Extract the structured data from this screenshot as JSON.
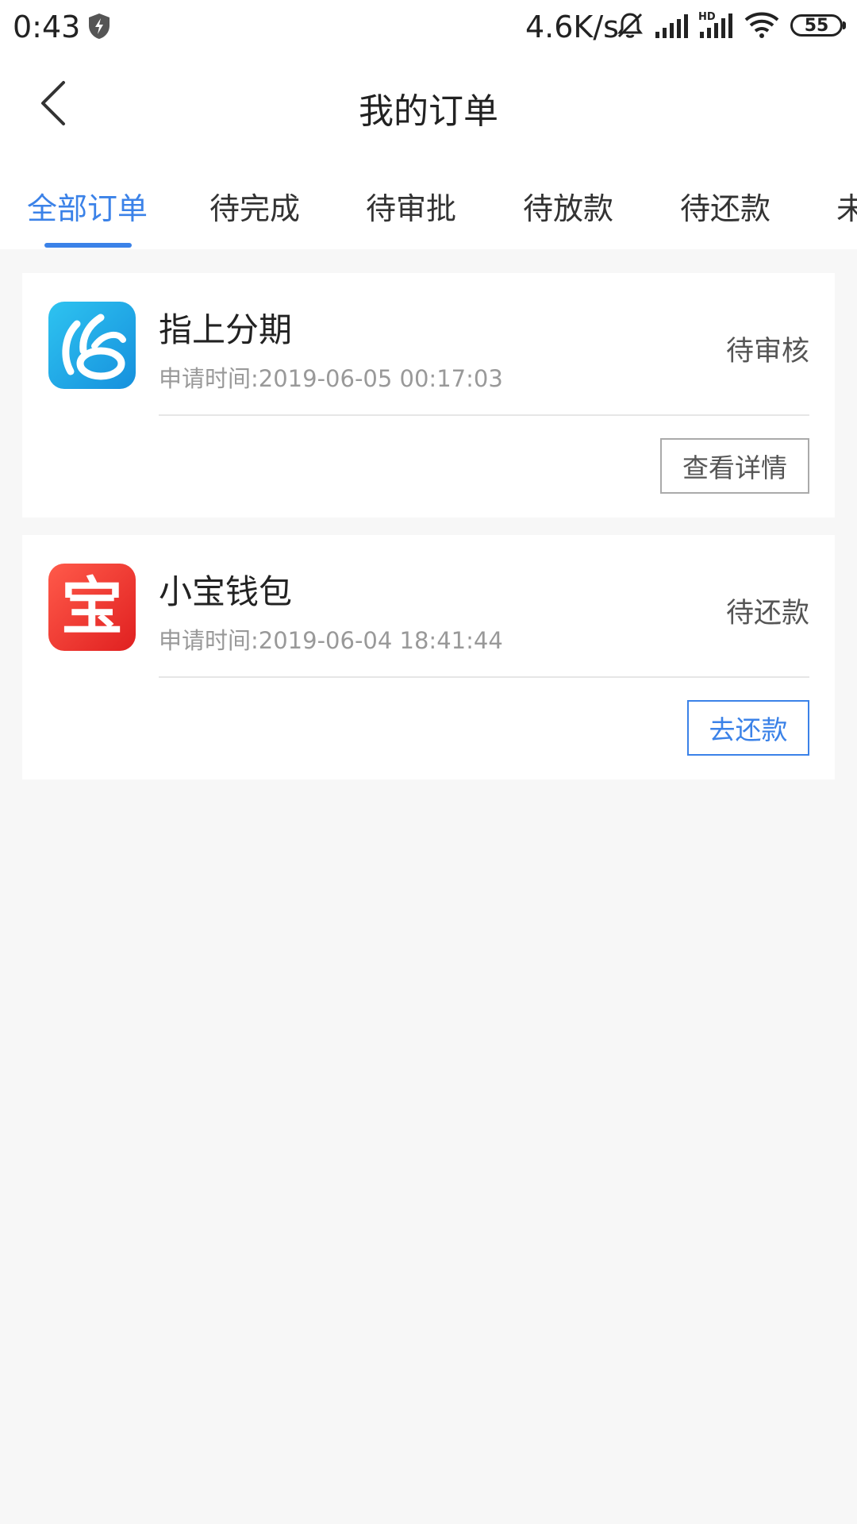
{
  "status_bar": {
    "time": "0:43",
    "net_speed": "4.6K/s",
    "hd": "HD",
    "battery": "55"
  },
  "header": {
    "title": "我的订单"
  },
  "tabs": [
    {
      "label": "全部订单",
      "active": true
    },
    {
      "label": "待完成"
    },
    {
      "label": "待审批"
    },
    {
      "label": "待放款"
    },
    {
      "label": "待还款"
    },
    {
      "label": "未"
    }
  ],
  "orders": [
    {
      "name": "指上分期",
      "time": "申请时间:2019-06-05 00:17:03",
      "status": "待审核",
      "action": "查看详情",
      "icon": "zhishang-app-icon"
    },
    {
      "name": "小宝钱包",
      "time": "申请时间:2019-06-04 18:41:44",
      "status": "待还款",
      "action": "去还款",
      "icon": "xiaobao-app-icon",
      "icon_glyph": "宝"
    }
  ],
  "colors": {
    "accent": "#3b82e8",
    "background": "#f7f7f7"
  }
}
